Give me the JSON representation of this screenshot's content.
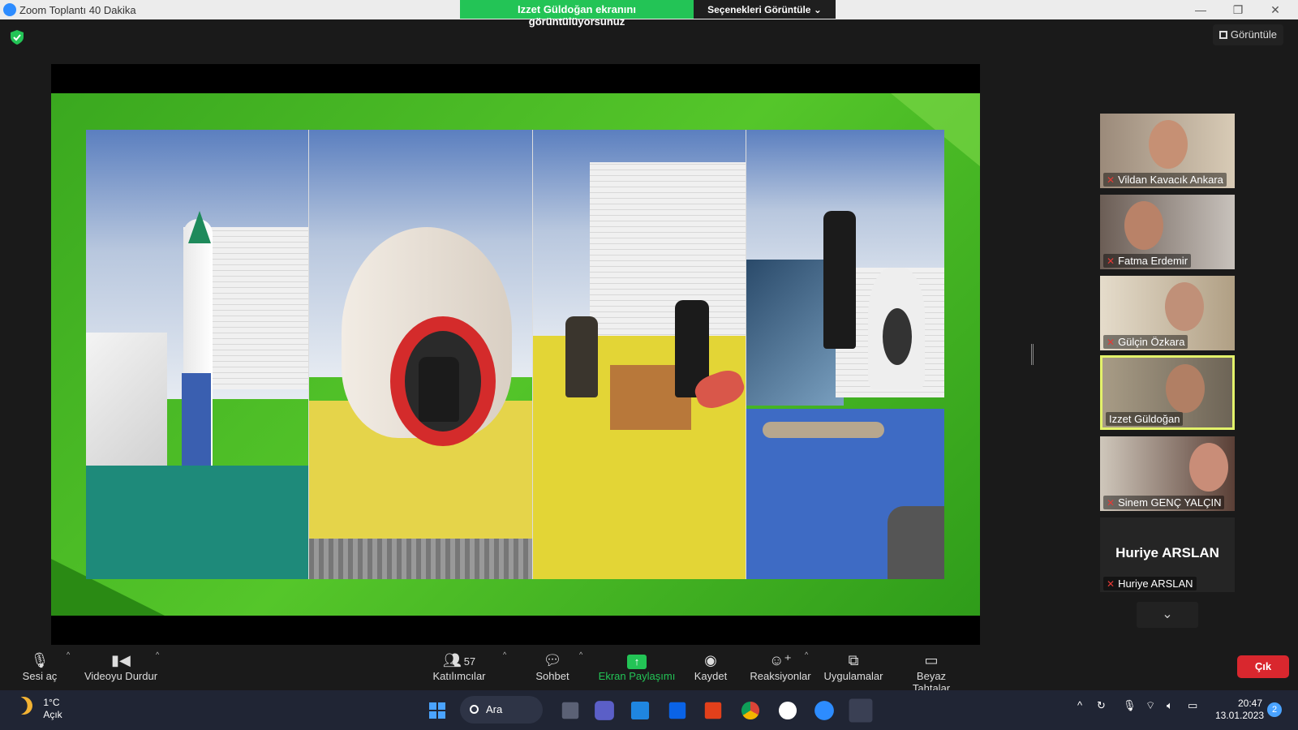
{
  "window": {
    "title": "Zoom Toplantı 40 Dakika",
    "controls": [
      "minimize",
      "maximize",
      "close"
    ]
  },
  "share_banner": {
    "message": "Izzet Güldoğan ekranını görüntülüyorsunuz",
    "options_label": "Seçenekleri Görüntüle"
  },
  "security_icon": "shield-check-icon",
  "view_button": {
    "label": "Görüntüle"
  },
  "participants": [
    {
      "name": "Vildan Kavacık Ankara",
      "muted": true,
      "active": false,
      "has_video": true
    },
    {
      "name": "Fatma Erdemir",
      "muted": true,
      "active": false,
      "has_video": true
    },
    {
      "name": "Gülçin Özkara",
      "muted": true,
      "active": false,
      "has_video": true
    },
    {
      "name": "Izzet Güldoğan",
      "muted": false,
      "active": true,
      "has_video": true
    },
    {
      "name": "Sinem GENÇ YALÇIN",
      "muted": true,
      "active": false,
      "has_video": true
    },
    {
      "name": "Huriye ARSLAN",
      "muted": true,
      "active": false,
      "has_video": false,
      "display_name": "Huriye ARSLAN"
    }
  ],
  "toolbar": {
    "mute": {
      "label": "Sesi aç",
      "icon": "mic-muted-icon"
    },
    "video": {
      "label": "Videoyu Durdur",
      "icon": "video-camera-icon"
    },
    "participants": {
      "label": "Katılımcılar",
      "count": "57",
      "icon": "participants-icon"
    },
    "chat": {
      "label": "Sohbet",
      "icon": "chat-bubble-icon"
    },
    "share": {
      "label": "Ekran Paylaşımı",
      "icon": "share-screen-icon"
    },
    "record": {
      "label": "Kaydet",
      "icon": "record-icon"
    },
    "reactions": {
      "label": "Reaksiyonlar",
      "icon": "smiley-plus-icon"
    },
    "apps": {
      "label": "Uygulamalar",
      "icon": "apps-icon"
    },
    "whiteboard": {
      "label": "Beyaz Tahtalar",
      "icon": "whiteboard-icon"
    },
    "exit": {
      "label": "Çık"
    }
  },
  "taskbar": {
    "weather": {
      "temp": "1°C",
      "condition": "Açık"
    },
    "search_label": "Ara",
    "clock": {
      "time": "20:47",
      "date": "13.01.2023"
    },
    "notifications": "2",
    "colors": {
      "accent": "#23c456",
      "exit": "#d9272e",
      "active_border": "#e3f26a"
    }
  }
}
